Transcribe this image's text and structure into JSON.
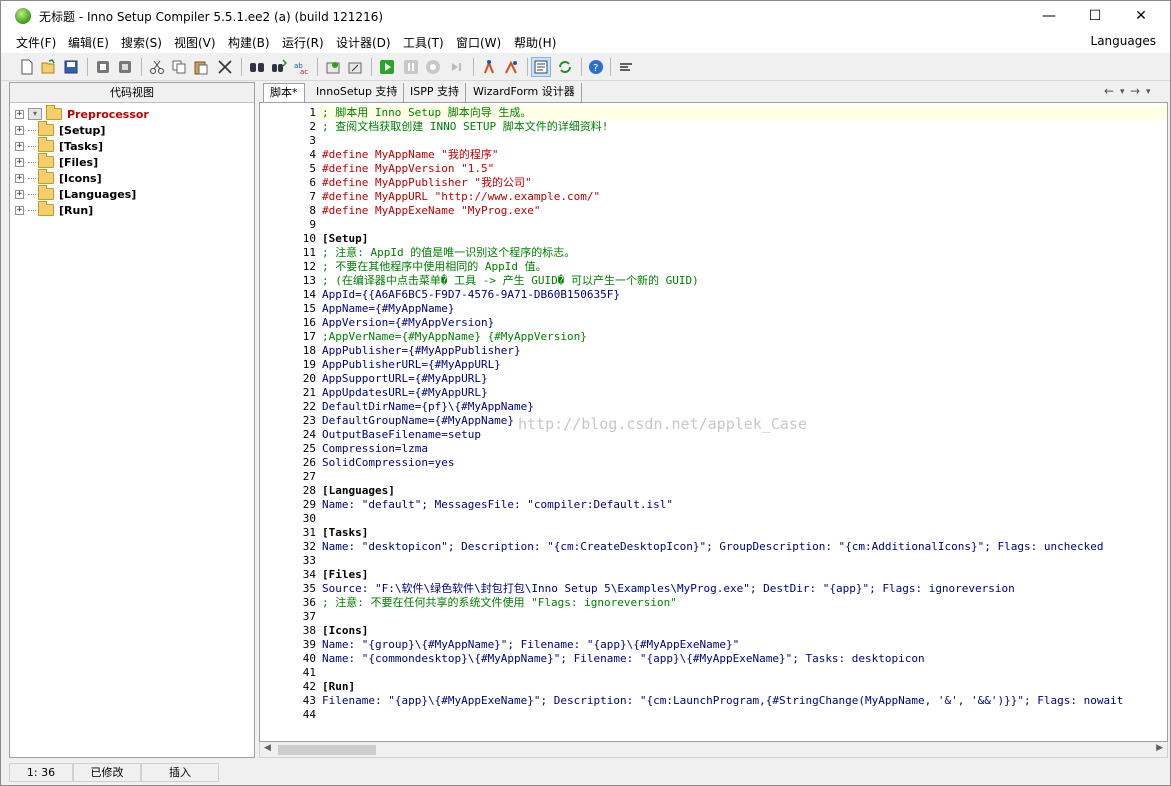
{
  "window": {
    "title": "无标题 - Inno Setup Compiler 5.5.1.ee2 (a) (build 121216)",
    "minimize_glyph": "—",
    "maximize_glyph": "☐",
    "close_glyph": "✕"
  },
  "menu": {
    "items": [
      "文件(F)",
      "编辑(E)",
      "搜索(S)",
      "视图(V)",
      "构建(B)",
      "运行(R)",
      "设计器(D)",
      "工具(T)",
      "窗口(W)",
      "帮助(H)"
    ],
    "languages": "Languages"
  },
  "toolbar": {
    "icons": [
      "new-file-icon",
      "open-folder-icon",
      "save-icon",
      "compile-icon",
      "stop-compile-icon",
      "cut-icon",
      "copy-icon",
      "paste-icon",
      "delete-icon",
      "find-icon",
      "find-next-icon",
      "replace-icon",
      "wizard-icon",
      "wizard-edit-icon",
      "run-icon",
      "pause-icon",
      "stop-icon",
      "step-icon",
      "designer-icon",
      "form-designer-icon",
      "code-view-icon",
      "refresh-icon",
      "help-icon",
      "options-icon"
    ]
  },
  "left_panel": {
    "header": "代码视图",
    "tree": [
      {
        "label": "Preprocessor",
        "color": "#c00000"
      },
      {
        "label": "[Setup]",
        "color": "#000000"
      },
      {
        "label": "[Tasks]",
        "color": "#000000"
      },
      {
        "label": "[Files]",
        "color": "#000000"
      },
      {
        "label": "[Icons]",
        "color": "#000000"
      },
      {
        "label": "[Languages]",
        "color": "#000000"
      },
      {
        "label": "[Run]",
        "color": "#000000"
      }
    ]
  },
  "tabs": [
    "脚本*",
    "InnoSetup 支持",
    "ISPP 支持",
    "WizardForm 设计器"
  ],
  "nav": {
    "back": "←",
    "forward": "→",
    "menu": "▾"
  },
  "editor": {
    "watermark": "http://blog.csdn.net/applek_Case",
    "lines": [
      {
        "n": "1",
        "t": "; 脚本用 Inno Setup 脚本向导 生成。",
        "c": "comment"
      },
      {
        "n": "2",
        "t": "; 查阅文档获取创建 INNO SETUP 脚本文件的详细资料!",
        "c": "comment"
      },
      {
        "n": "3",
        "t": "",
        "c": "plain"
      },
      {
        "n": "4",
        "t": "#define MyAppName \"我的程序\"",
        "c": "define"
      },
      {
        "n": "5",
        "t": "#define MyAppVersion \"1.5\"",
        "c": "define"
      },
      {
        "n": "6",
        "t": "#define MyAppPublisher \"我的公司\"",
        "c": "define"
      },
      {
        "n": "7",
        "t": "#define MyAppURL \"http://www.example.com/\"",
        "c": "define"
      },
      {
        "n": "8",
        "t": "#define MyAppExeName \"MyProg.exe\"",
        "c": "define"
      },
      {
        "n": "9",
        "t": "",
        "c": "plain"
      },
      {
        "n": "10",
        "t": "[Setup]",
        "c": "section"
      },
      {
        "n": "11",
        "t": "; 注意: AppId 的值是唯一识别这个程序的标志。",
        "c": "comment"
      },
      {
        "n": "12",
        "t": "; 不要在其他程序中使用相同的 AppId 值。",
        "c": "comment"
      },
      {
        "n": "13",
        "t": "; (在编译器中点击菜单� 工具 -> 产生 GUID� 可以产生一个新的 GUID)",
        "c": "comment"
      },
      {
        "n": "14",
        "t": "AppId={{A6AF6BC5-F9D7-4576-9A71-DB60B150635F}",
        "c": "key"
      },
      {
        "n": "15",
        "t": "AppName={#MyAppName}",
        "c": "key"
      },
      {
        "n": "16",
        "t": "AppVersion={#MyAppVersion}",
        "c": "key"
      },
      {
        "n": "17",
        "t": ";AppVerName={#MyAppName} {#MyAppVersion}",
        "c": "comment"
      },
      {
        "n": "18",
        "t": "AppPublisher={#MyAppPublisher}",
        "c": "key"
      },
      {
        "n": "19",
        "t": "AppPublisherURL={#MyAppURL}",
        "c": "key"
      },
      {
        "n": "20",
        "t": "AppSupportURL={#MyAppURL}",
        "c": "key"
      },
      {
        "n": "21",
        "t": "AppUpdatesURL={#MyAppURL}",
        "c": "key"
      },
      {
        "n": "22",
        "t": "DefaultDirName={pf}\\{#MyAppName}",
        "c": "key"
      },
      {
        "n": "23",
        "t": "DefaultGroupName={#MyAppName}",
        "c": "key"
      },
      {
        "n": "24",
        "t": "OutputBaseFilename=setup",
        "c": "key"
      },
      {
        "n": "25",
        "t": "Compression=lzma",
        "c": "key"
      },
      {
        "n": "26",
        "t": "SolidCompression=yes",
        "c": "key"
      },
      {
        "n": "27",
        "t": "",
        "c": "plain"
      },
      {
        "n": "28",
        "t": "[Languages]",
        "c": "section"
      },
      {
        "n": "29",
        "t": "Name: \"default\"; MessagesFile: \"compiler:Default.isl\"",
        "c": "key"
      },
      {
        "n": "30",
        "t": "",
        "c": "plain"
      },
      {
        "n": "31",
        "t": "[Tasks]",
        "c": "section"
      },
      {
        "n": "32",
        "t": "Name: \"desktopicon\"; Description: \"{cm:CreateDesktopIcon}\"; GroupDescription: \"{cm:AdditionalIcons}\"; Flags: unchecked",
        "c": "key"
      },
      {
        "n": "33",
        "t": "",
        "c": "plain"
      },
      {
        "n": "34",
        "t": "[Files]",
        "c": "section"
      },
      {
        "n": "35",
        "t": "Source: \"F:\\软件\\绿色软件\\封包打包\\Inno Setup 5\\Examples\\MyProg.exe\"; DestDir: \"{app}\"; Flags: ignoreversion",
        "c": "key"
      },
      {
        "n": "36",
        "t": "; 注意: 不要在任何共享的系统文件使用 \"Flags: ignoreversion\"",
        "c": "comment"
      },
      {
        "n": "37",
        "t": "",
        "c": "plain"
      },
      {
        "n": "38",
        "t": "[Icons]",
        "c": "section"
      },
      {
        "n": "39",
        "t": "Name: \"{group}\\{#MyAppName}\"; Filename: \"{app}\\{#MyAppExeName}\"",
        "c": "key"
      },
      {
        "n": "40",
        "t": "Name: \"{commondesktop}\\{#MyAppName}\"; Filename: \"{app}\\{#MyAppExeName}\"; Tasks: desktopicon",
        "c": "key"
      },
      {
        "n": "41",
        "t": "",
        "c": "plain"
      },
      {
        "n": "42",
        "t": "[Run]",
        "c": "section"
      },
      {
        "n": "43",
        "t": "Filename: \"{app}\\{#MyAppExeName}\"; Description: \"{cm:LaunchProgram,{#StringChange(MyAppName, '&', '&&')}}\"; Flags: nowait",
        "c": "key"
      },
      {
        "n": "44",
        "t": "",
        "c": "plain"
      }
    ]
  },
  "hscroll": {
    "left": "◀",
    "right": "▶"
  },
  "status": {
    "position": "1: 36",
    "modified": "已修改",
    "mode": "插入"
  }
}
